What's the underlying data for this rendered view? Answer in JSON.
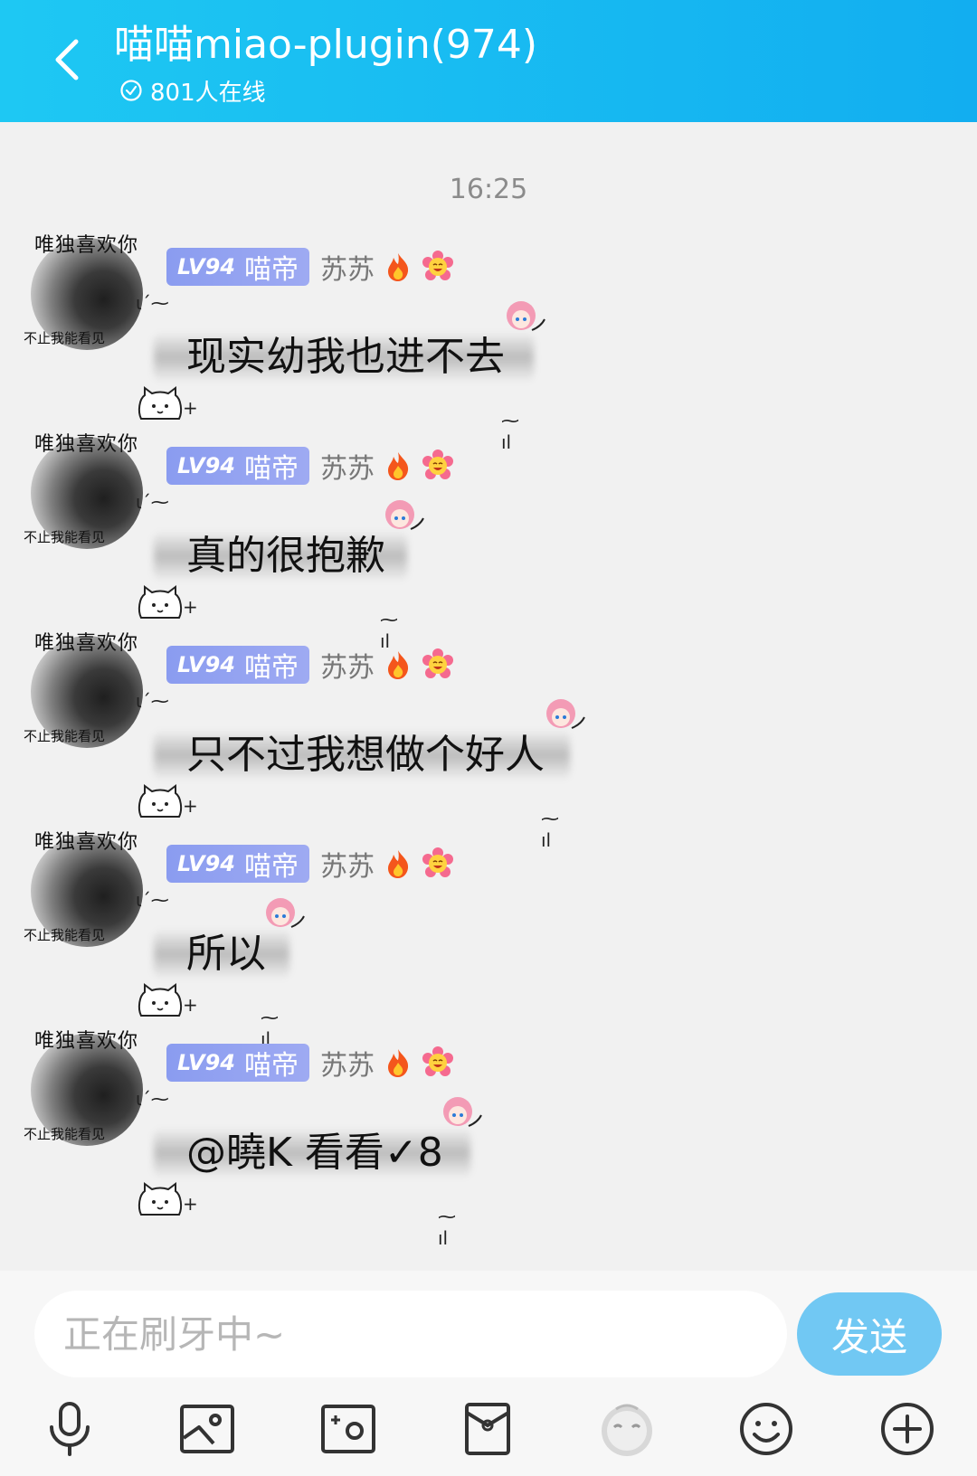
{
  "header": {
    "title": "喵喵miao-plugin(974)",
    "online_text": "801人在线"
  },
  "chat": {
    "timestamp": "16:25",
    "avatar": {
      "top_text": "唯独喜欢你",
      "bottom_text": "不止我能看见"
    },
    "messages": [
      {
        "level": "LV94",
        "title": "喵帝",
        "sender": "苏苏",
        "text": "现实幼我也进不去"
      },
      {
        "level": "LV94",
        "title": "喵帝",
        "sender": "苏苏",
        "text": "真的很抱歉"
      },
      {
        "level": "LV94",
        "title": "喵帝",
        "sender": "苏苏",
        "text": "只不过我想做个好人"
      },
      {
        "level": "LV94",
        "title": "喵帝",
        "sender": "苏苏",
        "text": "所以"
      },
      {
        "level": "LV94",
        "title": "喵帝",
        "sender": "苏苏",
        "text": "@曉K 看看✓8"
      }
    ]
  },
  "input": {
    "placeholder": "正在刷牙中~",
    "send_label": "发送"
  },
  "toolbar": {
    "items": [
      "microphone-icon",
      "image-icon",
      "camera-icon",
      "red-packet-icon",
      "emoji-sticker-icon",
      "smiley-icon",
      "plus-icon"
    ]
  },
  "colors": {
    "header_start": "#1ec8f3",
    "header_end": "#12aef0",
    "badge": "#8a9cf0",
    "send_button": "#71c8f3",
    "background": "#f1f1f1"
  }
}
